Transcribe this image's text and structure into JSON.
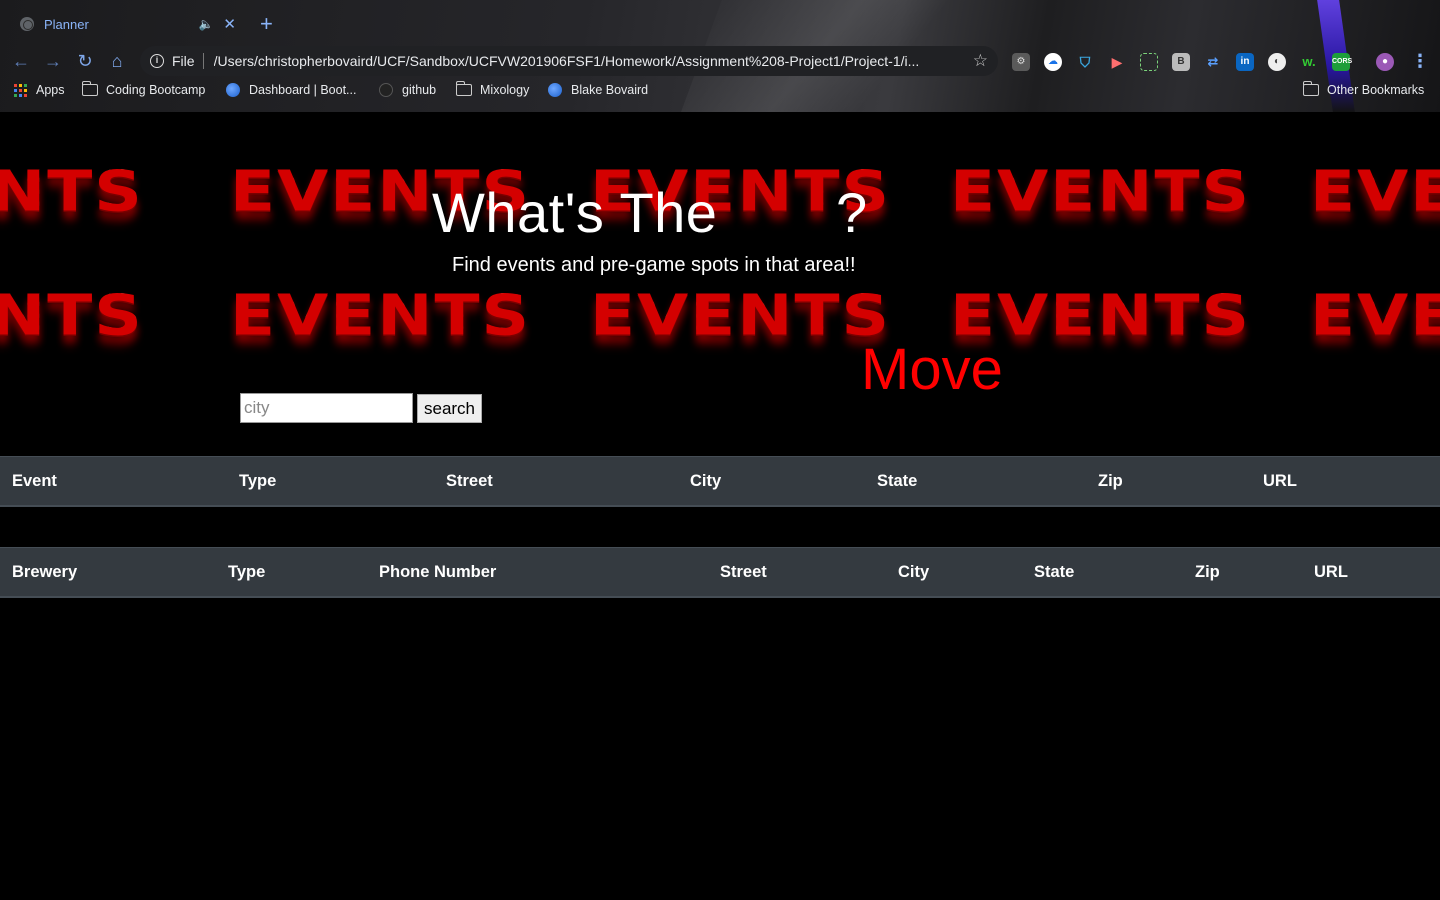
{
  "browser": {
    "tab_title": "Planner",
    "new_tab_symbol": "+",
    "close_symbol": "✕",
    "omnibox": {
      "scheme": "File",
      "url": "/Users/christopherbovaird/UCF/Sandbox/UCFVW201906FSF1/Homework/Assignment%208-Project1/Project-1/i..."
    },
    "bookmarks": [
      {
        "label": "Apps",
        "icon": "apps-grid-icon"
      },
      {
        "label": "Coding Bootcamp",
        "icon": "folder-icon"
      },
      {
        "label": "Dashboard | Boot...",
        "icon": "globe-icon"
      },
      {
        "label": "github",
        "icon": "github-icon"
      },
      {
        "label": "Mixology",
        "icon": "folder-icon"
      },
      {
        "label": "Blake Bovaird",
        "icon": "globe-icon"
      }
    ],
    "other_bookmarks": "Other Bookmarks",
    "accent_color": "#8ab4f8"
  },
  "hero": {
    "title": "What's The",
    "title_mark": "?",
    "subtitle": "Find events and pre-game spots in that area!!",
    "move_word": "Move",
    "move_color": "#ff0000",
    "background_word": "EVENTS",
    "background_tail": "EVE",
    "background_head": "NTS"
  },
  "search": {
    "placeholder": "city",
    "value": "",
    "button_label": "search"
  },
  "events_table": {
    "headers": [
      "Event",
      "Type",
      "Street",
      "City",
      "State",
      "Zip",
      "URL"
    ]
  },
  "brewery_table": {
    "headers": [
      "Brewery",
      "Type",
      "Phone Number",
      "Street",
      "City",
      "State",
      "Zip",
      "URL"
    ]
  }
}
